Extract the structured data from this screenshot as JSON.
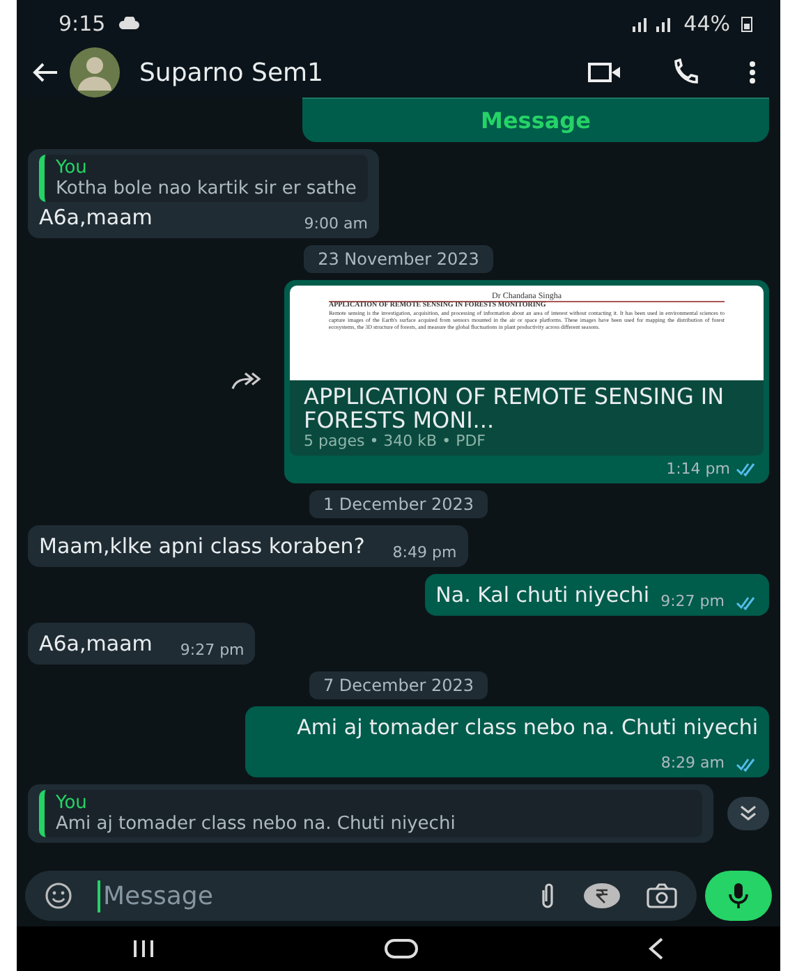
{
  "status_bar": {
    "time": "9:15",
    "battery": "44%"
  },
  "header": {
    "contact_name": "Suparno Sem1"
  },
  "messages": [
    {
      "kind": "button_card",
      "button": "Message"
    },
    {
      "kind": "incoming",
      "quote": {
        "author": "You",
        "text": "Kotha bole nao kartik sir er sathe"
      },
      "text": "A6a,maam",
      "time": "9:00 am"
    },
    {
      "kind": "date",
      "text": "23 November 2023"
    },
    {
      "kind": "document",
      "preview_author": "Dr Chandana Singha",
      "preview_title": "APPLICATION OF REMOTE SENSING IN FORESTS MONITORING",
      "preview_body": "Remote sensing is the investigation, acquisition, and processing of information about an area of interest without contacting it. It has been used in environmental sciences to capture images of the Earth's surface acquired from sensors mounted in the air or space platforms. These images have been used for mapping the distribution of forest ecosystems, the 3D structure of forests, and measure the global fluctuations in plant productivity across different seasons.",
      "title": "APPLICATION OF REMOTE SENSING IN FORESTS MONI...",
      "meta": "5 pages • 340 kB • PDF",
      "time": "1:14 pm",
      "read": true
    },
    {
      "kind": "date",
      "text": "1 December 2023"
    },
    {
      "kind": "incoming",
      "text": "Maam,klke apni class koraben?",
      "time": "8:49 pm"
    },
    {
      "kind": "outgoing",
      "text": "Na. Kal chuti niyechi",
      "time": "9:27 pm",
      "read": true
    },
    {
      "kind": "incoming",
      "text": "A6a,maam",
      "time": "9:27 pm"
    },
    {
      "kind": "date",
      "text": "7 December 2023"
    },
    {
      "kind": "outgoing",
      "text": "Ami aj tomader class nebo na. Chuti niyechi",
      "time": "8:29 am",
      "read": true
    },
    {
      "kind": "quote_fragment",
      "author": "You",
      "text": "Ami aj tomader class nebo na. Chuti niyechi"
    }
  ],
  "composer": {
    "placeholder": "Message"
  }
}
